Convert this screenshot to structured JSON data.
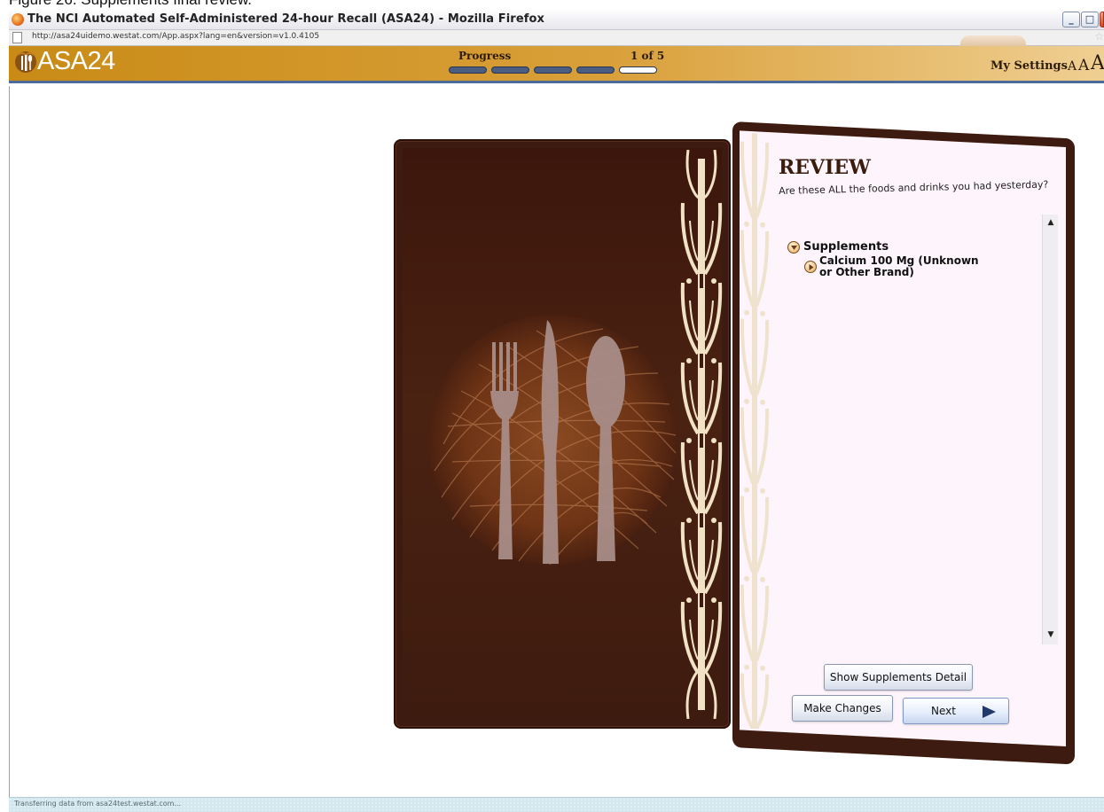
{
  "caption": {
    "text": "Figure 26. Supplements final review."
  },
  "window": {
    "title": "The NCI Automated Self-Administered 24-hour Recall (ASA24) - Mozilla Firefox",
    "controls": {
      "minimize": "_",
      "maximize": "□",
      "close": "X"
    }
  },
  "browser": {
    "url": "http://asa24uidemo.westat.com/App.aspx?lang=en&version=v1.0.4105",
    "status": "Transferring data from asa24test.westat.com..."
  },
  "header": {
    "logo_text": "ASA24",
    "progress_label": "Progress",
    "progress_count": "1 of 5",
    "progress_current": 5,
    "progress_total": 5,
    "settings_label": "My Settings",
    "font_sizes": [
      "A",
      "A",
      "A"
    ]
  },
  "review": {
    "title": "REVIEW",
    "question": "Are these ALL the foods and drinks you had yesterday?",
    "groups": [
      {
        "label": "Supplements",
        "expanded": true,
        "items": [
          {
            "label": "Calcium 100 Mg (Unknown or Other Brand)"
          }
        ]
      }
    ],
    "scroll": {
      "up": "▲",
      "down": "▼"
    },
    "buttons": {
      "detail": "Show Supplements Detail",
      "changes": "Make Changes",
      "next": "Next"
    }
  },
  "colors": {
    "header_gold": "#c98b16",
    "book_brown": "#3e1b10",
    "page_cream": "#fdf5fb",
    "accent_blue": "#213a6b"
  }
}
